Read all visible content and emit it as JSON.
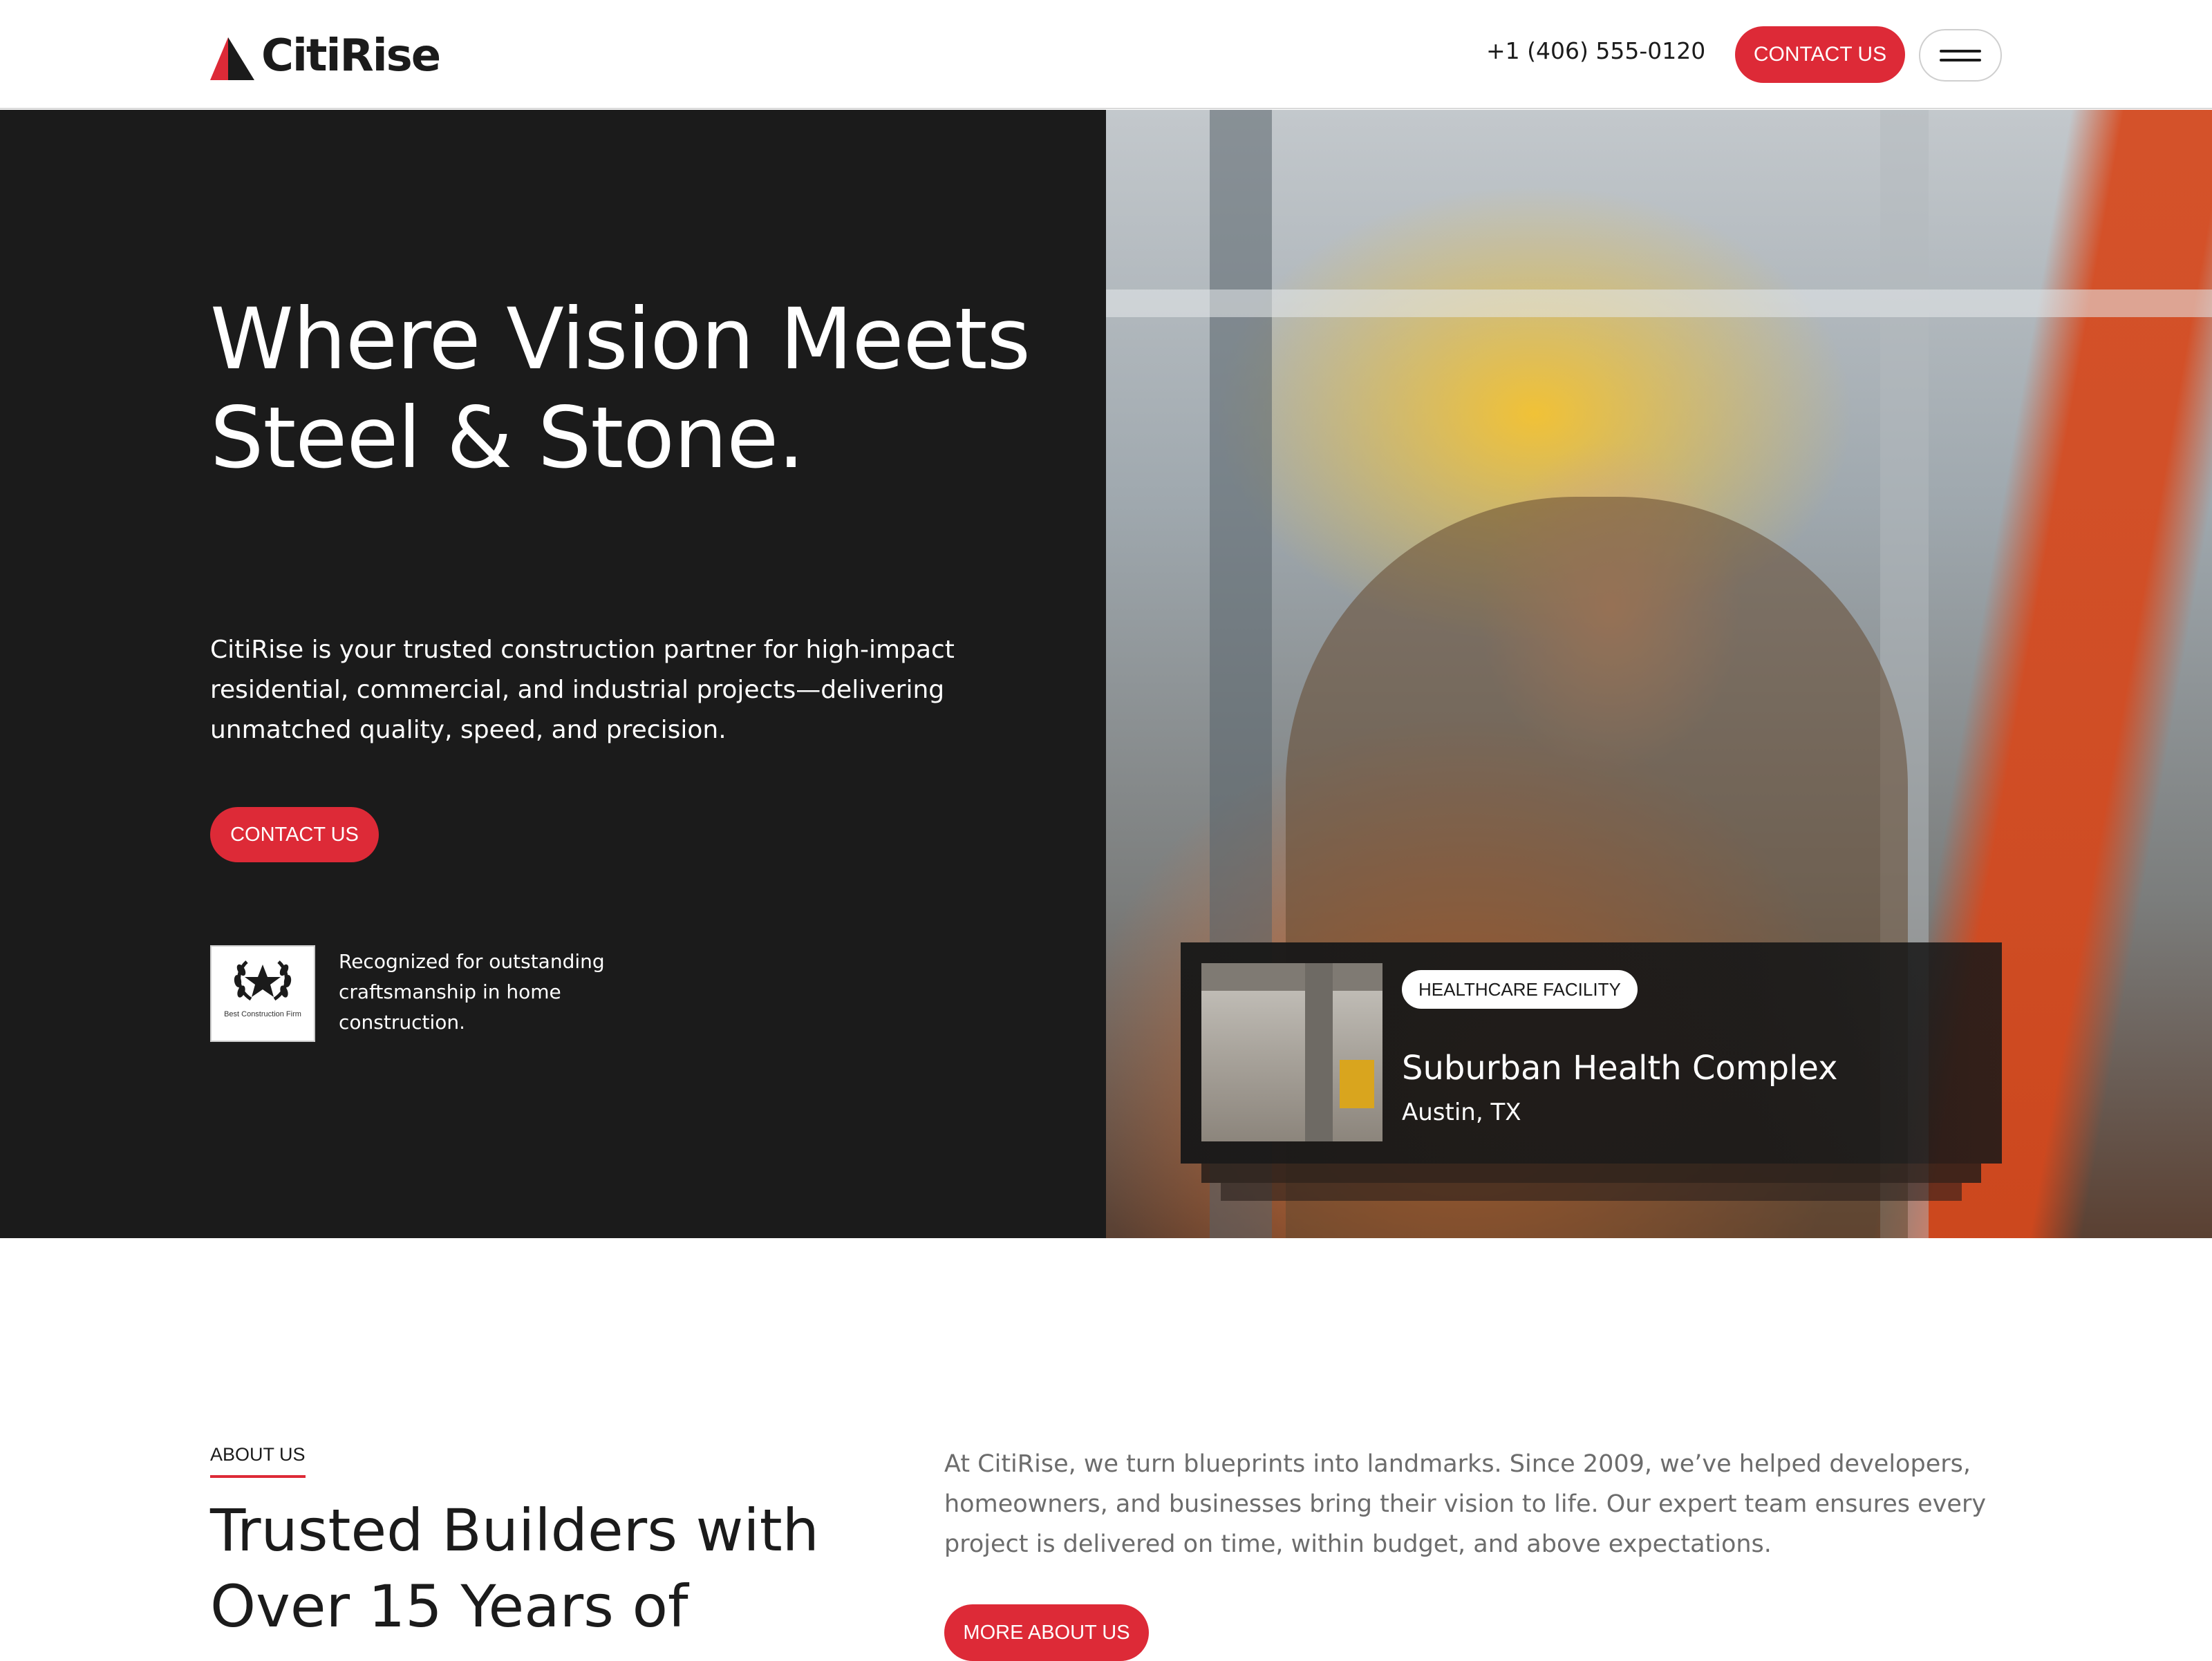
{
  "header": {
    "brand": "CitiRise",
    "phone": "+1 (406) 555-0120",
    "cta_label": "CONTACT US"
  },
  "hero": {
    "title": "Where Vision Meets Steel & Stone.",
    "description": "CitiRise is your trusted construction partner for high-impact residential, commercial, and industrial projects—delivering unmatched quality, speed, and precision.",
    "cta_label": "CONTACT US",
    "award": {
      "badge_caption": "Best Construction Firm",
      "text": "Recognized for outstanding craftsmanship in home construction."
    },
    "project_card": {
      "tag": "HEALTHCARE FACILITY",
      "title": "Suburban Health Complex",
      "location": "Austin, TX"
    }
  },
  "about": {
    "label": "ABOUT US",
    "title": "Trusted Builders with Over 15 Years of",
    "description": "At CitiRise, we turn blueprints into landmarks. Since 2009, we’ve helped developers, homeowners, and businesses bring their vision to life. Our expert team ensures every project is delivered on time, within budget, and above expectations.",
    "cta_label": "MORE ABOUT US"
  },
  "colors": {
    "accent": "#dd2a37",
    "dark": "#1b1b1b",
    "text_muted": "#6c6c6c"
  },
  "icons": [
    "logo-mark-icon",
    "menu-icon",
    "laurel-star-icon"
  ]
}
